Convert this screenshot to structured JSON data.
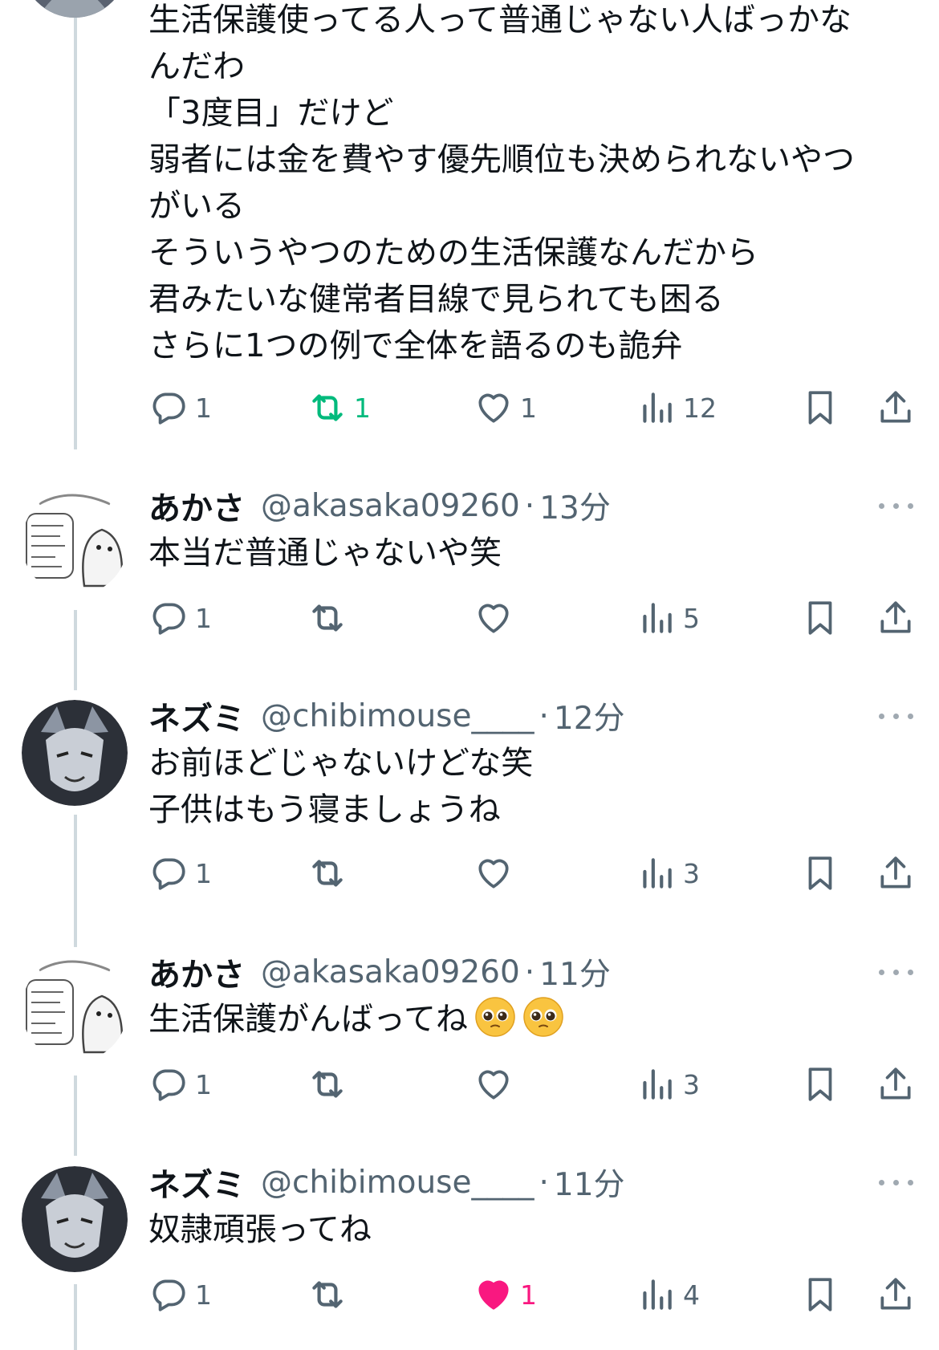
{
  "tweets": [
    {
      "name": "",
      "handle": "",
      "time": "",
      "lines": [
        "生活保護使ってる人って普通じゃない人ばっかな",
        "んだわ",
        "「3度目」だけど",
        "弱者には金を費やす優先順位も決められないやつ",
        "がいる",
        "そういうやつのための生活保護なんだから",
        "君みたいな健常者目線で見られても困る",
        "さらに1つの例で全体を語るのも詭弁"
      ],
      "reply_count": "1",
      "retweet_count": "1",
      "like_count": "1",
      "view_count": "12",
      "retweeted": true,
      "liked": false
    },
    {
      "name": "あかさ",
      "handle": "@akasaka09260",
      "time": "13分",
      "lines": [
        "本当だ普通じゃないや笑"
      ],
      "reply_count": "1",
      "retweet_count": "",
      "like_count": "",
      "view_count": "5"
    },
    {
      "name": "ネズミ",
      "handle": "@chibimouse____",
      "time": "12分",
      "lines": [
        "お前ほどじゃないけどな笑",
        "子供はもう寝ましょうね"
      ],
      "reply_count": "1",
      "retweet_count": "",
      "like_count": "",
      "view_count": "3"
    },
    {
      "name": "あかさ",
      "handle": "@akasaka09260",
      "time": "11分",
      "lines": [
        "生活保護がんばってね"
      ],
      "emoji": "pleading-face-emoji",
      "reply_count": "1",
      "retweet_count": "",
      "like_count": "",
      "view_count": "3"
    },
    {
      "name": "ネズミ",
      "handle": "@chibimouse____",
      "time": "11分",
      "lines": [
        "奴隷頑張ってね"
      ],
      "reply_count": "1",
      "retweet_count": "",
      "like_count": "1",
      "view_count": "4",
      "liked": true
    }
  ],
  "separator": "·",
  "colors": {
    "text": "#0f1419",
    "secondary": "#536471",
    "thread_line": "#cfd9de",
    "retweet_active": "#00ba7c",
    "like_active": "#f91880"
  },
  "icons": [
    "reply-icon",
    "retweet-icon",
    "heart-icon",
    "views-icon",
    "bookmark-icon",
    "share-icon",
    "more-icon"
  ]
}
